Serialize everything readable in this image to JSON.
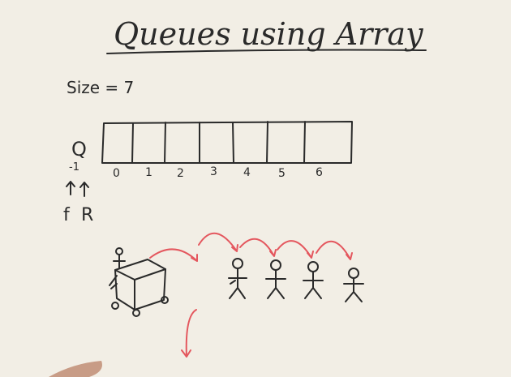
{
  "title": "Queues using Array",
  "size_label": "Size = 7",
  "array_name": "Q",
  "indices": [
    "0",
    "1",
    "2",
    "3",
    "4",
    "5",
    "6"
  ],
  "initial_index": "-1",
  "front_label": "f",
  "rear_label": "R",
  "colors": {
    "ink": "#2a2a2a",
    "arrow": "#e4575e",
    "board": "#f2eee5"
  }
}
